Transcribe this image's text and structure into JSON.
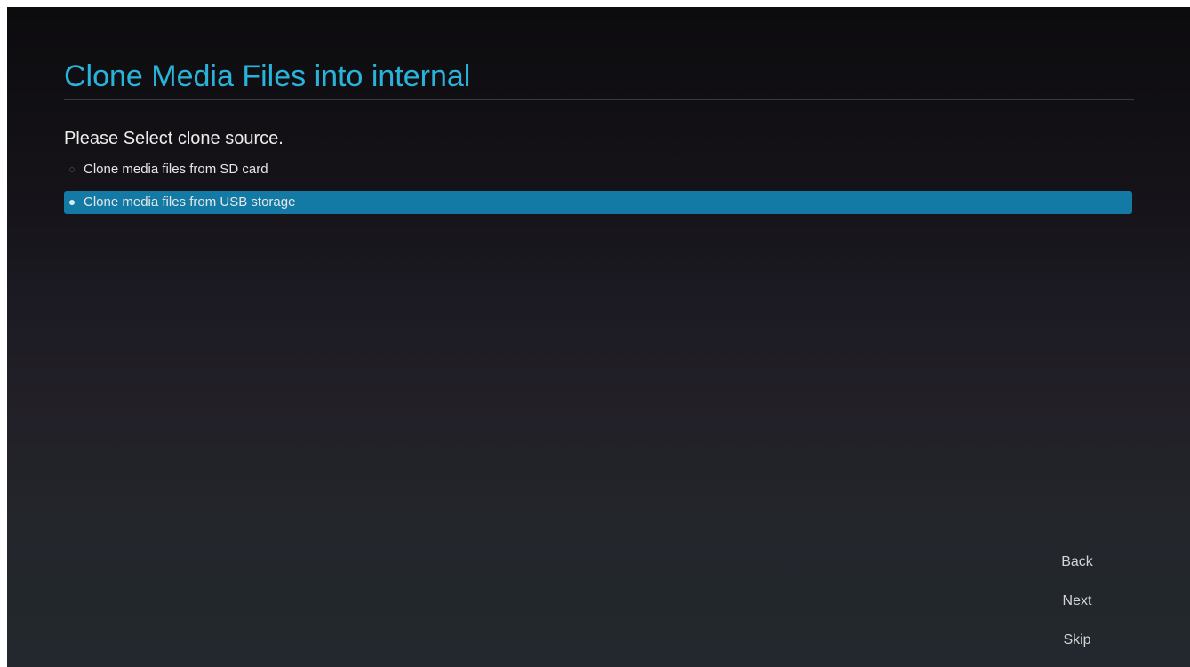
{
  "page": {
    "title": "Clone Media Files into internal",
    "prompt": "Please Select clone source."
  },
  "options": [
    {
      "label": "Clone media files from SD card",
      "selected": false
    },
    {
      "label": "Clone media files from USB storage",
      "selected": true
    }
  ],
  "nav": {
    "back_label": "Back",
    "next_label": "Next",
    "skip_label": "Skip"
  },
  "colors": {
    "title": "#29b3d9",
    "selection": "#137aa6",
    "text": "#ececec"
  }
}
